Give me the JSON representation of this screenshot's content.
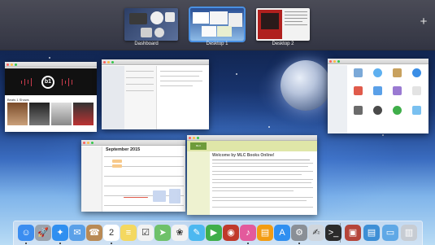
{
  "spaces": [
    {
      "label": "Dashboard",
      "active": false
    },
    {
      "label": "Desktop 1",
      "active": true
    },
    {
      "label": "Desktop 2",
      "active": false
    }
  ],
  "add_space_label": "+",
  "windows": {
    "itunes": {
      "section_label": "Beats 1 Shows"
    },
    "calendar": {
      "month_label": "September 2015"
    },
    "book_site": {
      "logo_text": "MLC",
      "title": "Welcome by MLC Books Online!"
    }
  },
  "dock": {
    "apps": [
      {
        "name": "finder-icon",
        "glyph": "☺",
        "color": "#3b8df0",
        "running": true
      },
      {
        "name": "launchpad-icon",
        "glyph": "🚀",
        "color": "#9aa3ad",
        "running": false
      },
      {
        "name": "safari-icon",
        "glyph": "✦",
        "color": "#2f8ff0",
        "running": true
      },
      {
        "name": "mail-icon",
        "glyph": "✉",
        "color": "#5aa0e8",
        "running": false
      },
      {
        "name": "contacts-icon",
        "glyph": "☎",
        "color": "#b98a55",
        "running": false
      },
      {
        "name": "calendar-icon",
        "glyph": "2",
        "color": "#ffffff",
        "running": true
      },
      {
        "name": "notes-icon",
        "glyph": "≡",
        "color": "#f4d860",
        "running": false
      },
      {
        "name": "reminders-icon",
        "glyph": "☑",
        "color": "#f2f2f2",
        "running": false
      },
      {
        "name": "maps-icon",
        "glyph": "➤",
        "color": "#6fc16a",
        "running": false
      },
      {
        "name": "photos-icon",
        "glyph": "❀",
        "color": "#f2f2f2",
        "running": false
      },
      {
        "name": "messages-icon",
        "glyph": "✎",
        "color": "#4cb8f0",
        "running": false
      },
      {
        "name": "facetime-icon",
        "glyph": "▶",
        "color": "#3fae4a",
        "running": false
      },
      {
        "name": "photobooth-icon",
        "glyph": "◉",
        "color": "#c0392b",
        "running": false
      },
      {
        "name": "itunes-icon",
        "glyph": "♪",
        "color": "#e35a9c",
        "running": true
      },
      {
        "name": "ibooks-icon",
        "glyph": "▤",
        "color": "#f39c12",
        "running": false
      },
      {
        "name": "appstore-icon",
        "glyph": "A",
        "color": "#2f8ff0",
        "running": false
      },
      {
        "name": "preferences-icon",
        "glyph": "⚙",
        "color": "#8a8f96",
        "running": true
      },
      {
        "name": "textedit-icon",
        "glyph": "✍",
        "color": "#d0d6dd",
        "running": false
      },
      {
        "name": "terminal-icon",
        "glyph": ">_",
        "color": "#2b2b2b",
        "running": false
      }
    ],
    "stacks": [
      {
        "name": "downloads-icon",
        "glyph": "▣",
        "color": "#b5453a"
      },
      {
        "name": "documents-icon",
        "glyph": "▤",
        "color": "#3d8fd6"
      },
      {
        "name": "folder-icon",
        "glyph": "▭",
        "color": "#5fa8e6"
      },
      {
        "name": "trash-icon",
        "glyph": "▥",
        "color": "#c7ccd3"
      }
    ]
  }
}
